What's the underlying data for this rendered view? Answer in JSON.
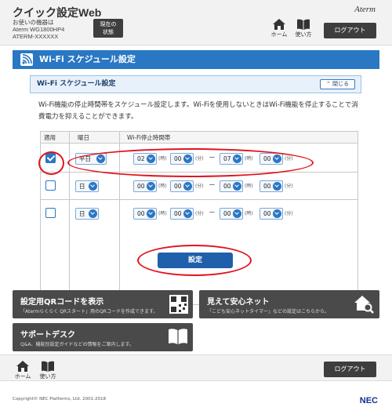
{
  "header": {
    "app_title": "クイック設定Web",
    "device_line1": "お使いの機器は",
    "device_line2": "Aterm WG1800HP4",
    "device_line3": "ATERM-XXXXXX",
    "status_line1": "現在の",
    "status_line2": "状態",
    "brand": "Aterm",
    "home_label": "ホーム",
    "manual_label": "使い方",
    "logout_label": "ログアウト"
  },
  "section": {
    "title": "Wi-Fi スケジュール設定"
  },
  "panel": {
    "title": "Wi-Fi スケジュール設定",
    "collapse_label": "閉じる",
    "description": "Wi-Fi機能の停止時間帯をスケジュール設定します。Wi-Fiを使用しないときはWi-Fi機能を停止することで消費電力を抑えることができます。"
  },
  "table": {
    "headers": {
      "apply": "適用",
      "day": "曜日",
      "stop_time": "Wi-Fi停止時間帯"
    },
    "units": {
      "hour": "(時)",
      "minute": "(分)"
    },
    "dash": "－",
    "rows": [
      {
        "checked": true,
        "day": "平日",
        "start_h": "02",
        "start_m": "00",
        "end_h": "07",
        "end_m": "00"
      },
      {
        "checked": false,
        "day": "日",
        "start_h": "00",
        "start_m": "00",
        "end_h": "00",
        "end_m": "00"
      },
      {
        "checked": false,
        "day": "日",
        "start_h": "00",
        "start_m": "00",
        "end_h": "00",
        "end_m": "00"
      }
    ]
  },
  "submit_label": "設定",
  "links": {
    "qr_title": "設定用QRコードを表示",
    "qr_sub": "「Atermらくらく QRスタート」用のQRコードを作成できます。",
    "safe_title": "見えて安心ネット",
    "safe_sub": "「こども安心ネットタイマー」などの設定はこちらから。",
    "support_title": "サポートデスク",
    "support_sub": "Q&A、機能別設定ガイドなどの情報をご案内します。"
  },
  "footer": {
    "home_label": "ホーム",
    "manual_label": "使い方",
    "logout_label": "ログアウト",
    "copyright": "Copyright© NEC Platforms, Ltd. 2001-2018",
    "brand": "NEC"
  },
  "colors": {
    "accent": "#2a77c4",
    "highlight": "#e0141e",
    "dark_button": "#3e3e3e"
  }
}
